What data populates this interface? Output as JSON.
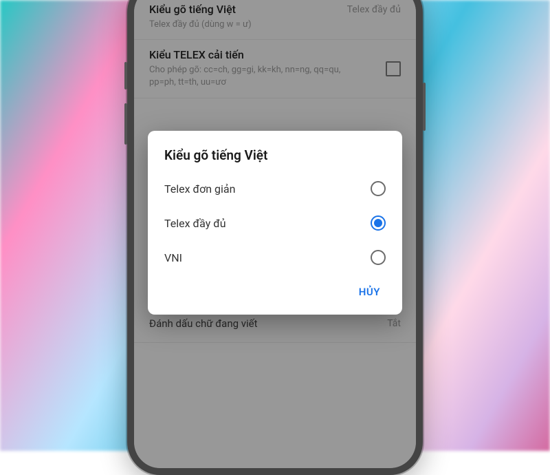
{
  "settings": {
    "row1": {
      "title": "Kiểu gõ tiếng Việt",
      "sub": "Telex đầy đủ (dùng w = ư)",
      "value": "Telex đầy đủ"
    },
    "row2": {
      "title": "Kiểu TELEX cải tiến",
      "sub": "Cho phép gõ: cc=ch, gg=gi, kk=kh, nn=ng, qq=qu, pp=ph, tt=th, uu=ươ"
    },
    "last": {
      "title": "Đánh dấu chữ đang viết",
      "value": "Tắt"
    }
  },
  "dialog": {
    "title": "Kiểu gõ tiếng Việt",
    "options": [
      {
        "label": "Telex đơn giản",
        "selected": false
      },
      {
        "label": "Telex đầy đủ",
        "selected": true
      },
      {
        "label": "VNI",
        "selected": false
      }
    ],
    "cancel": "HỦY"
  }
}
